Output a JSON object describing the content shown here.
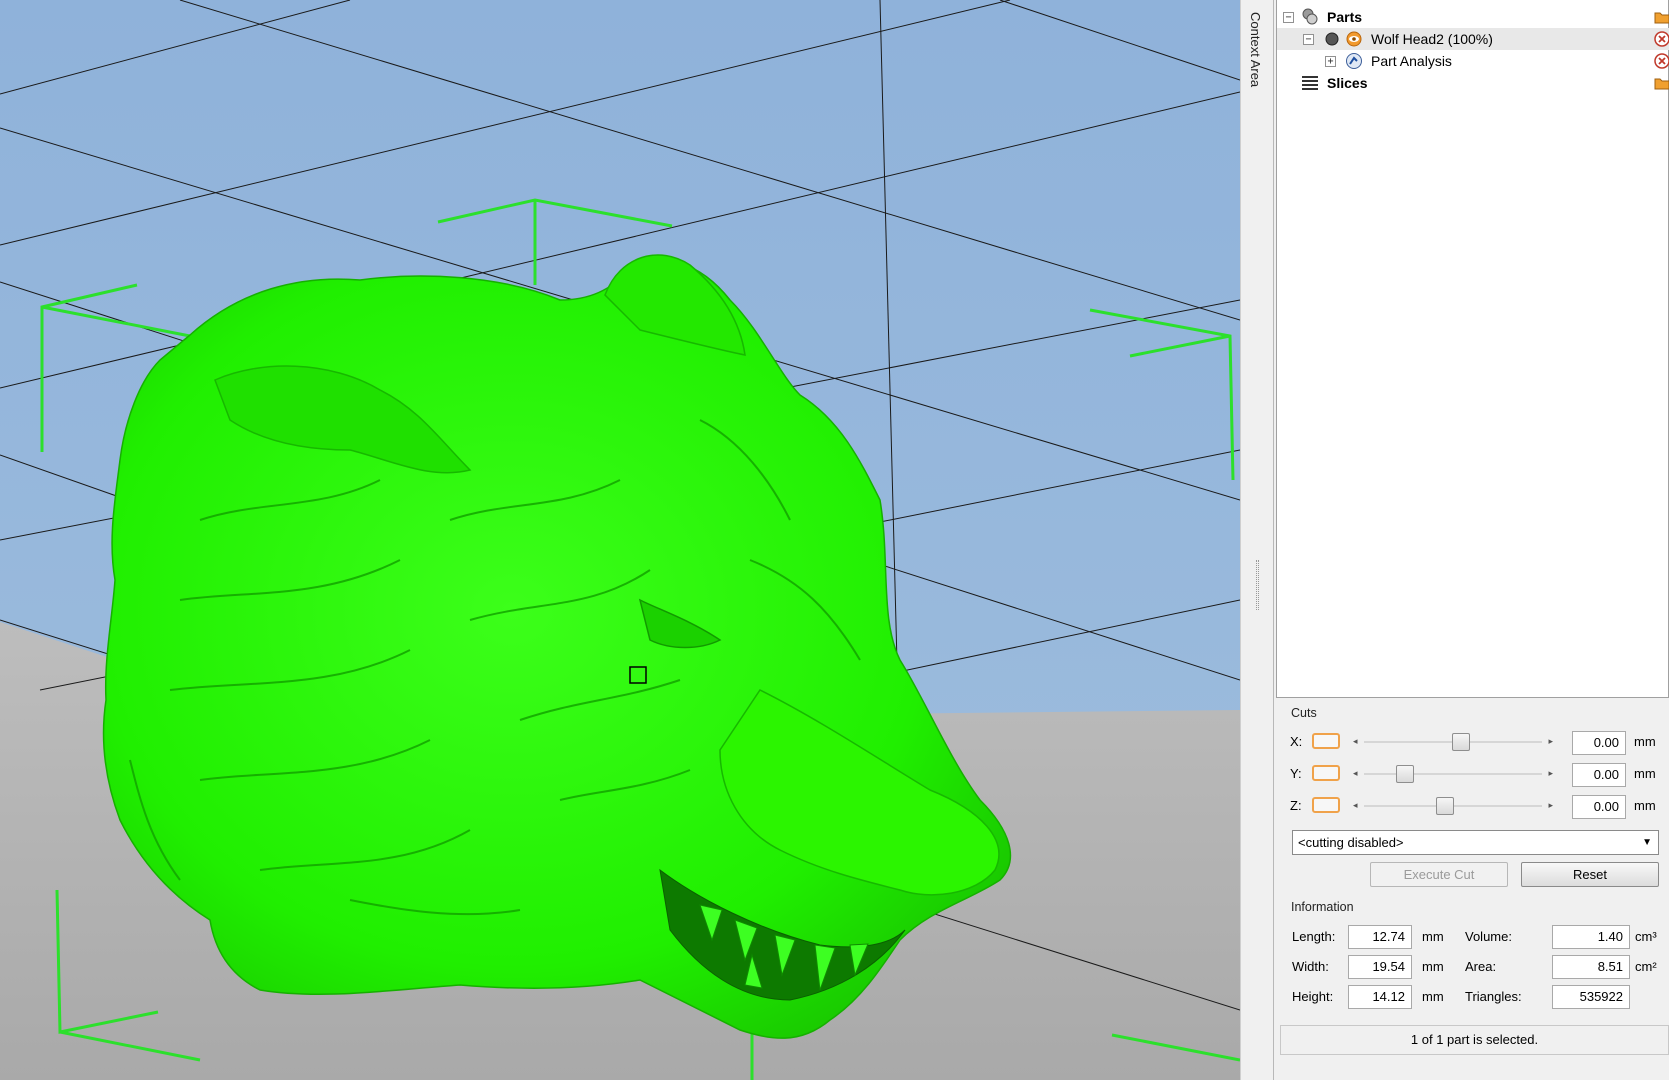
{
  "context_area": {
    "label": "Context Area"
  },
  "tree": {
    "parts": {
      "label": "Parts"
    },
    "part": {
      "label": "Wolf Head2 (100%)"
    },
    "analysis": {
      "label": "Part Analysis"
    },
    "slices": {
      "label": "Slices"
    }
  },
  "cuts": {
    "title": "Cuts",
    "axes": [
      {
        "label": "X:",
        "value": "0.00",
        "unit": "mm",
        "slider_fraction": 0.55
      },
      {
        "label": "Y:",
        "value": "0.00",
        "unit": "mm",
        "slider_fraction": 0.2
      },
      {
        "label": "Z:",
        "value": "0.00",
        "unit": "mm",
        "slider_fraction": 0.45
      }
    ],
    "mode_select": "<cutting disabled>",
    "execute_label": "Execute Cut",
    "reset_label": "Reset"
  },
  "information": {
    "title": "Information",
    "length_label": "Length:",
    "length_value": "12.74",
    "length_unit": "mm",
    "width_label": "Width:",
    "width_value": "19.54",
    "width_unit": "mm",
    "height_label": "Height:",
    "height_value": "14.12",
    "height_unit": "mm",
    "volume_label": "Volume:",
    "volume_value": "1.40",
    "volume_unit": "cm³",
    "area_label": "Area:",
    "area_value": "8.51",
    "area_unit": "cm²",
    "triangles_label": "Triangles:",
    "triangles_value": "535922"
  },
  "status": "1 of 1 part is selected.",
  "colors": {
    "sky": "#98b8db",
    "floor": "#b4b4b4",
    "model": "#21f000",
    "bounding_box": "#2ce02c",
    "accent_orange": "#f0a24a"
  },
  "icons": {
    "parts": "parts-icon",
    "part": "part-visible-icon",
    "analysis": "part-analysis-icon",
    "slices": "slices-icon",
    "folder": "folder-icon",
    "remove": "remove-icon"
  }
}
